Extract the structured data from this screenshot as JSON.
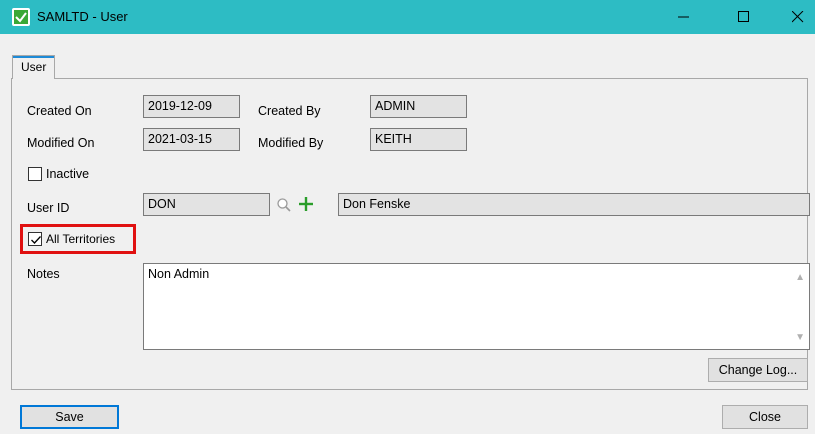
{
  "window": {
    "title": "SAMLTD - User"
  },
  "tabs": [
    {
      "label": "User"
    }
  ],
  "form": {
    "created_on_label": "Created On",
    "created_on_value": "2019-12-09",
    "created_by_label": "Created By",
    "created_by_value": "ADMIN",
    "modified_on_label": "Modified On",
    "modified_on_value": "2021-03-15",
    "modified_by_label": "Modified By",
    "modified_by_value": "KEITH",
    "inactive_label": "Inactive",
    "inactive_checked": false,
    "user_id_label": "User ID",
    "user_id_value": "DON",
    "user_name_value": "Don Fenske",
    "all_territories_label": "All Territories",
    "all_territories_checked": true,
    "notes_label": "Notes",
    "notes_value": "Non Admin"
  },
  "buttons": {
    "change_log": "Change Log...",
    "save": "Save",
    "close": "Close"
  },
  "icons": {
    "app": "samltd-app-icon",
    "lookup": "search-icon",
    "add": "plus-icon"
  },
  "colors": {
    "titlebar": "#2dbcc4",
    "highlight": "#e01010",
    "add_icon": "#2a9d2a",
    "accent": "#0078d7"
  }
}
